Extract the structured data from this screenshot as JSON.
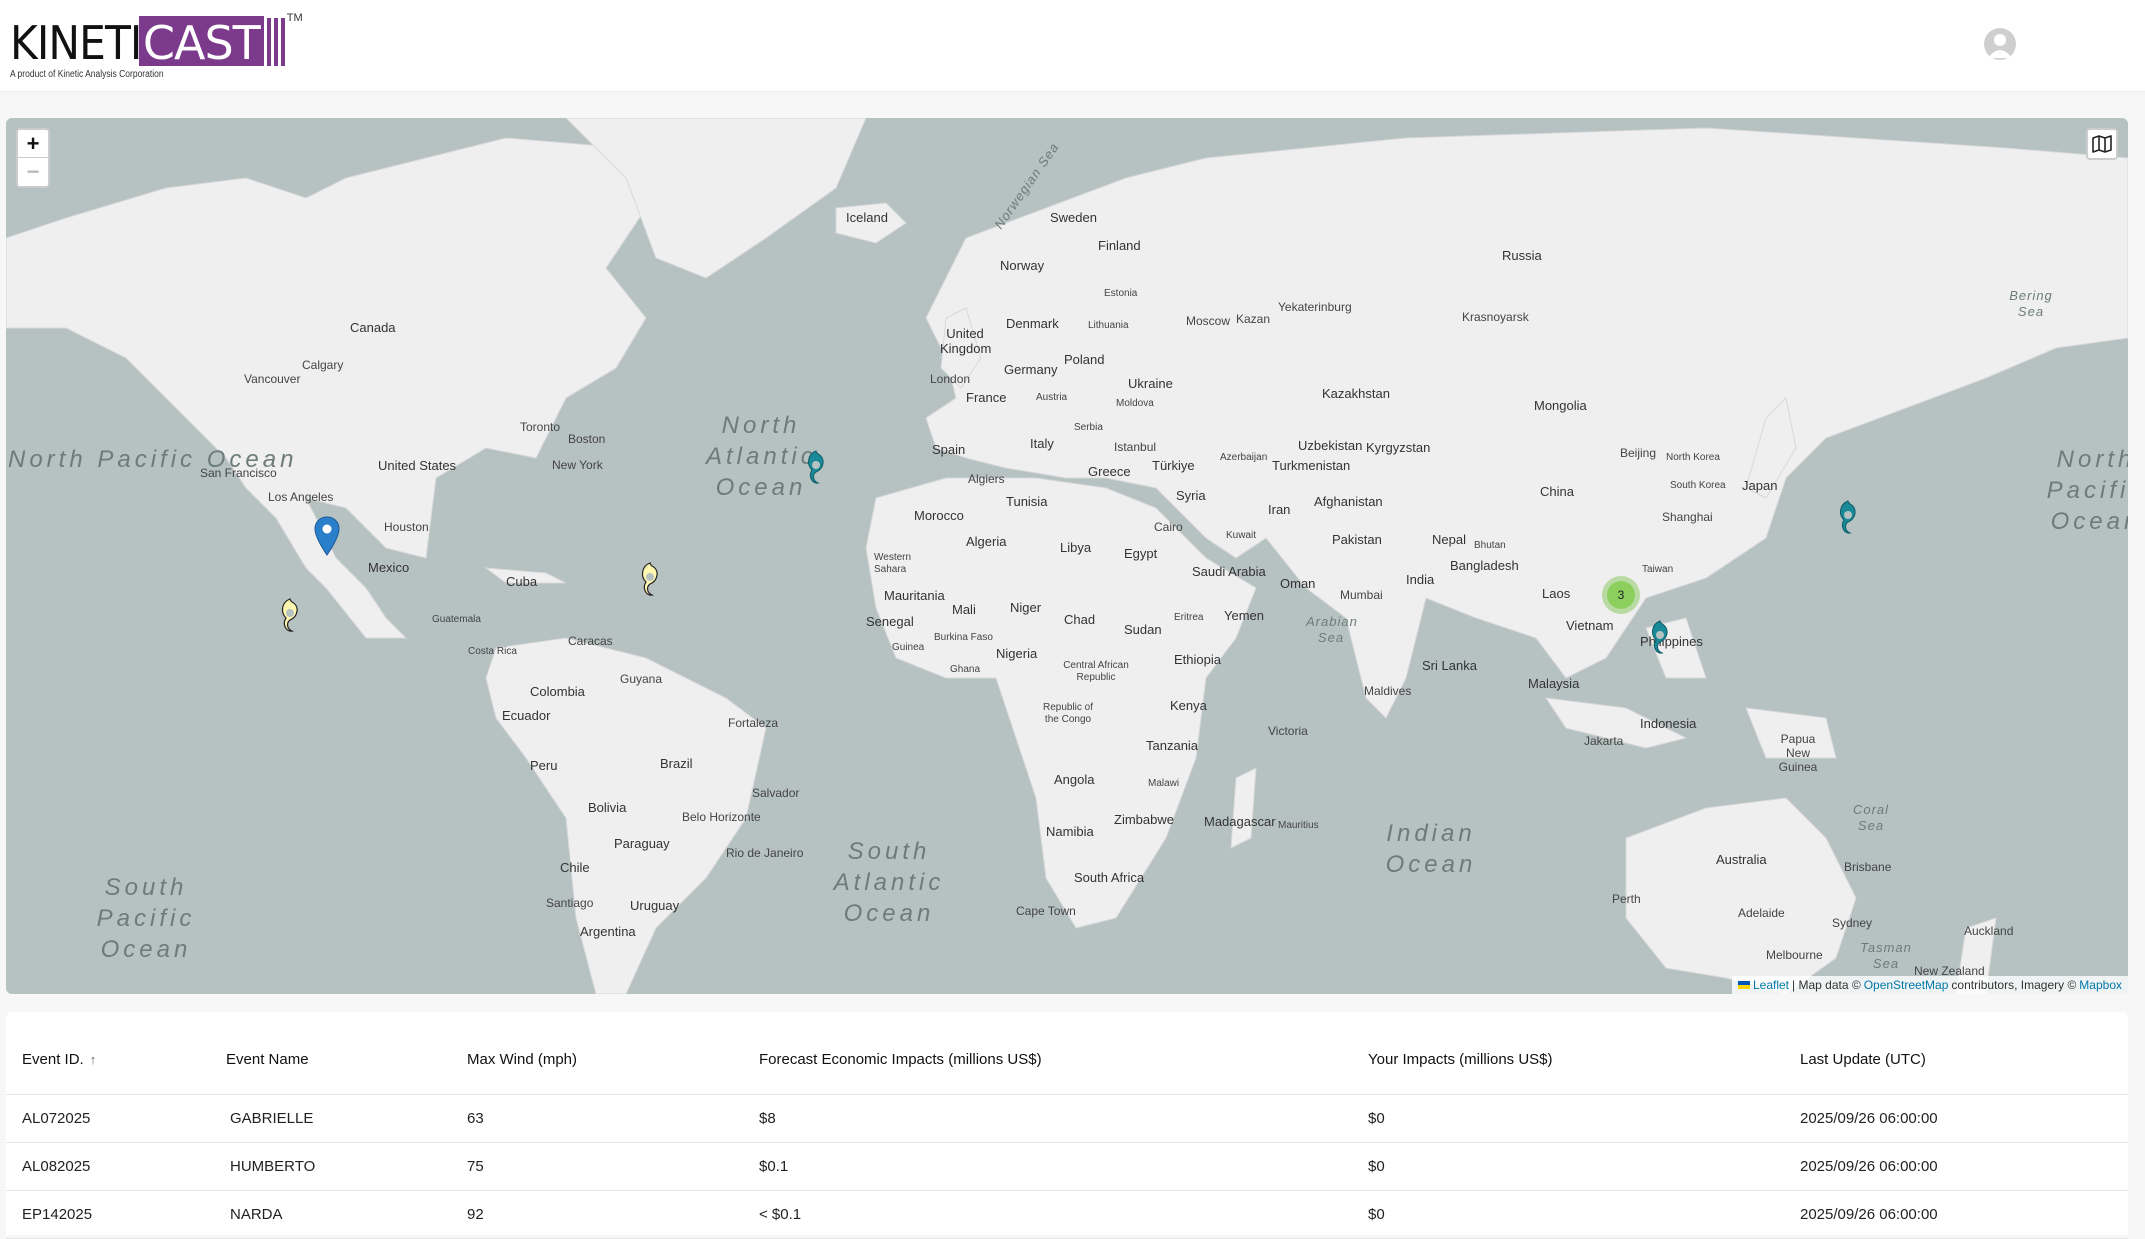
{
  "logo": {
    "part1": "KINETI",
    "part2": "CAST",
    "tm": "TM",
    "subtitle": "A product of Kinetic Analysis Corporation"
  },
  "map": {
    "zoom_in": "+",
    "zoom_out": "−",
    "attribution": {
      "leaflet": "Leaflet",
      "sep": "| Map data ©",
      "osm": "OpenStreetMap",
      "mid": "contributors, Imagery ©",
      "mapbox": "Mapbox"
    },
    "cluster_count": "3",
    "labels": {
      "canada": "Canada",
      "us": "United States",
      "mexico": "Mexico",
      "cuba": "Cuba",
      "guatemala": "Guatemala",
      "costarica": "Costa Rica",
      "colombia": "Colombia",
      "ecuador": "Ecuador",
      "peru": "Peru",
      "brazil": "Brazil",
      "bolivia": "Bolivia",
      "paraguay": "Paraguay",
      "chile": "Chile",
      "argentina": "Argentina",
      "uruguay": "Uruguay",
      "guyana": "Guyana",
      "vancouver": "Vancouver",
      "calgary": "Calgary",
      "sanfrancisco": "San Francisco",
      "losangeles": "Los Angeles",
      "houston": "Houston",
      "toronto": "Toronto",
      "boston": "Boston",
      "newyork": "New York",
      "caracas": "Caracas",
      "fortaleza": "Fortaleza",
      "salvador": "Salvador",
      "belohorizonte": "Belo Horizonte",
      "riodejaneiro": "Rio de Janeiro",
      "santiago": "Santiago",
      "iceland": "Iceland",
      "norway": "Norway",
      "sweden": "Sweden",
      "finland": "Finland",
      "estonia": "Estonia",
      "denmark": "Denmark",
      "lithuania": "Lithuania",
      "uk": "United Kingdom",
      "london": "London",
      "germany": "Germany",
      "poland": "Poland",
      "france": "France",
      "austria": "Austria",
      "ukraine": "Ukraine",
      "moldova": "Moldova",
      "serbia": "Serbia",
      "italy": "Italy",
      "spain": "Spain",
      "istanbul": "Istanbul",
      "greece": "Greece",
      "turkiye": "Türkiye",
      "azerbaijan": "Azerbaijan",
      "russia": "Russia",
      "moscow": "Moscow",
      "kazan": "Kazan",
      "yekaterinburg": "Yekaterinburg",
      "krasnoyarsk": "Krasnoyarsk",
      "kazakhstan": "Kazakhstan",
      "mongolia": "Mongolia",
      "uzbekistan": "Uzbekistan",
      "kyrgyzstan": "Kyrgyzstan",
      "turkmenistan": "Turkmenistan",
      "beijing": "Beijing",
      "northkorea": "North Korea",
      "southkorea": "South Korea",
      "japan": "Japan",
      "china": "China",
      "shanghai": "Shanghai",
      "taiwan": "Taiwan",
      "syria": "Syria",
      "iran": "Iran",
      "afghanistan": "Afghanistan",
      "kuwait": "Kuwait",
      "pakistan": "Pakistan",
      "nepal": "Nepal",
      "bhutan": "Bhutan",
      "bangladesh": "Bangladesh",
      "india": "India",
      "mumbai": "Mumbai",
      "laos": "Laos",
      "vietnam": "Vietnam",
      "philippines": "Philippines",
      "srilanka": "Sri Lanka",
      "maldives": "Maldives",
      "malaysia": "Malaysia",
      "indonesia": "Indonesia",
      "jakarta": "Jakarta",
      "png": "Papua New Guinea",
      "australia": "Australia",
      "brisbane": "Brisbane",
      "sydney": "Sydney",
      "adelaide": "Adelaide",
      "melbourne": "Melbourne",
      "perth": "Perth",
      "auckland": "Auckland",
      "newzealand": "New Zealand",
      "morocco": "Morocco",
      "algiers": "Algiers",
      "tunisia": "Tunisia",
      "algeria": "Algeria",
      "libya": "Libya",
      "egypt": "Egypt",
      "cairo": "Cairo",
      "saudi": "Saudi Arabia",
      "oman": "Oman",
      "yemen": "Yemen",
      "westernsahara": "Western Sahara",
      "mauritania": "Mauritania",
      "mali": "Mali",
      "niger": "Niger",
      "chad": "Chad",
      "sudan": "Sudan",
      "eritrea": "Eritrea",
      "senegal": "Senegal",
      "guinea": "Guinea",
      "burkina": "Burkina Faso",
      "nigeria": "Nigeria",
      "ghana": "Ghana",
      "car": "Central African Republic",
      "ethiopia": "Ethiopia",
      "congo": "Republic of the Congo",
      "kenya": "Kenya",
      "tanzania": "Tanzania",
      "angola": "Angola",
      "malawi": "Malawi",
      "zimbabwe": "Zimbabwe",
      "namibia": "Namibia",
      "southafrica": "South Africa",
      "capetown": "Cape Town",
      "madagascar": "Madagascar",
      "mauritius": "Mauritius",
      "victoria": "Victoria"
    },
    "oceans": {
      "npac_w": "North Pacific Ocean",
      "natl": "North Atlantic Ocean",
      "npac_e": "North Pacific Ocean",
      "spac": "South Pacific Ocean",
      "satl": "South Atlantic Ocean",
      "indian": "Indian Ocean",
      "norwegian": "Norwegian Sea",
      "bering": "Bering Sea",
      "arabian": "Arabian Sea",
      "coral": "Coral Sea",
      "tasman": "Tasman Sea"
    },
    "colors": {
      "water": "#b6c2c1",
      "land": "#efefef",
      "storm_teal": "#1a8a99",
      "storm_yellow": "#fff6b0",
      "pin_blue": "#2a7fcb",
      "cluster": "#8ccf5c"
    }
  },
  "table": {
    "headers": [
      "Event ID.",
      "Event Name",
      "Max Wind (mph)",
      "Forecast Economic Impacts (millions US$)",
      "Your Impacts (millions US$)",
      "Last Update (UTC)"
    ],
    "sort_indicator": "↑",
    "rows": [
      [
        "AL072025",
        "GABRIELLE",
        "63",
        "$8",
        "$0",
        "2025/09/26 06:00:00"
      ],
      [
        "AL082025",
        "HUMBERTO",
        "75",
        "$0.1",
        "$0",
        "2025/09/26 06:00:00"
      ],
      [
        "EP142025",
        "NARDA",
        "92",
        "< $0.1",
        "$0",
        "2025/09/26 06:00:00"
      ]
    ]
  }
}
